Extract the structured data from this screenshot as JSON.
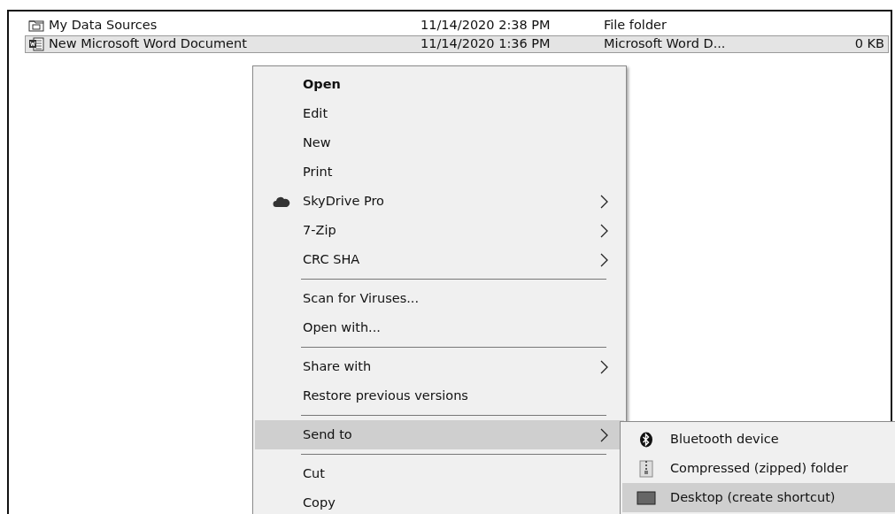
{
  "files": [
    {
      "name": "My Data Sources",
      "date": "11/14/2020 2:38 PM",
      "type": "File folder",
      "selected": false
    },
    {
      "name": "New Microsoft Word Document",
      "date": "11/14/2020 1:36 PM",
      "type": "Microsoft Word D...",
      "size": "0 KB",
      "selected": true
    }
  ],
  "context_menu": {
    "items": [
      {
        "kind": "item",
        "label": "Open",
        "default": true,
        "submenu": false,
        "selected": false
      },
      {
        "kind": "item",
        "label": "Edit",
        "default": false,
        "submenu": false,
        "selected": false
      },
      {
        "kind": "item",
        "label": "New",
        "default": false,
        "submenu": false,
        "selected": false
      },
      {
        "kind": "item",
        "label": "Print",
        "default": false,
        "submenu": false,
        "selected": false
      },
      {
        "kind": "item",
        "label": "SkyDrive Pro",
        "default": false,
        "submenu": true,
        "selected": false
      },
      {
        "kind": "item",
        "label": "7-Zip",
        "default": false,
        "submenu": true,
        "selected": false
      },
      {
        "kind": "item",
        "label": "CRC SHA",
        "default": false,
        "submenu": true,
        "selected": false
      },
      {
        "kind": "separator"
      },
      {
        "kind": "item",
        "label": "Scan for Viruses...",
        "default": false,
        "submenu": false,
        "selected": false
      },
      {
        "kind": "item",
        "label": "Open with...",
        "default": false,
        "submenu": false,
        "selected": false
      },
      {
        "kind": "separator"
      },
      {
        "kind": "item",
        "label": "Share with",
        "default": false,
        "submenu": true,
        "selected": false
      },
      {
        "kind": "item",
        "label": "Restore previous versions",
        "default": false,
        "submenu": false,
        "selected": false
      },
      {
        "kind": "separator"
      },
      {
        "kind": "item",
        "label": "Send to",
        "default": false,
        "submenu": true,
        "selected": true
      },
      {
        "kind": "separator"
      },
      {
        "kind": "item",
        "label": "Cut",
        "default": false,
        "submenu": false,
        "selected": false
      },
      {
        "kind": "item",
        "label": "Copy",
        "default": false,
        "submenu": false,
        "selected": false
      }
    ]
  },
  "send_to_menu": {
    "items": [
      {
        "label": "Bluetooth device",
        "selected": false
      },
      {
        "label": "Compressed (zipped) folder",
        "selected": false
      },
      {
        "label": "Desktop (create shortcut)",
        "selected": true
      }
    ]
  }
}
